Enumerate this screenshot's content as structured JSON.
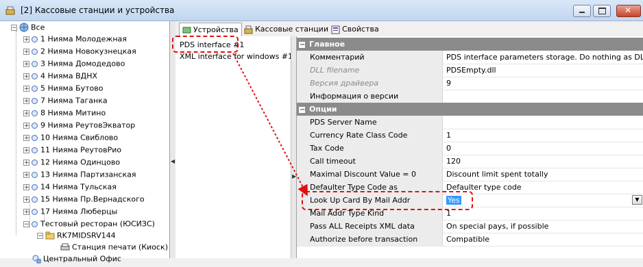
{
  "window": {
    "title": "[2] Кассовые станции и устройства"
  },
  "tree": {
    "root": "Все",
    "items": [
      "1 Нияма Молодежная",
      "2 Нияма Новокузнецкая",
      "3 Нияма Домодедово",
      "4 Нияма ВДНХ",
      "5 Нияма Бутово",
      "7 Нияма Таганка",
      "8 Нияма Митино",
      "9 Нияма РеутовЭкватор",
      "10 Нияма Свиблово",
      "11 Нияма РеутовРио",
      "12 Нияма Одинцово",
      "13 Нияма Партизанская",
      "14 Нияма Тульская",
      "15 Нияма Пр.Вернадского",
      "17 Нияма Люберцы",
      "Тестовый ресторан (ЮСИЗС)"
    ],
    "station": "RK7MIDSRV144",
    "device": "Станция печати (Киоск)",
    "office": "Центральный Офис"
  },
  "tabs": [
    {
      "label": "Устройства"
    },
    {
      "label": "Кассовые станции"
    },
    {
      "label": "Свойства"
    }
  ],
  "interfaces": [
    "PDS interface #1",
    "XML interface for windows #1"
  ],
  "grid": {
    "cat_main": "Главное",
    "main_rows": [
      {
        "name": "Комментарий",
        "value": "PDS interface parameters storage. Do nothing as DLL.",
        "readonly": false
      },
      {
        "name": "DLL filename",
        "value": "PDSEmpty.dll",
        "readonly": true
      },
      {
        "name": "Версия драйвера",
        "value": "9",
        "readonly": true
      },
      {
        "name": "Информация о версии",
        "value": "",
        "readonly": false
      }
    ],
    "cat_options": "Опции",
    "option_rows": [
      {
        "name": "PDS Server Name",
        "value": ""
      },
      {
        "name": "Currency Rate Class Code",
        "value": "1"
      },
      {
        "name": "Tax Code",
        "value": "0"
      },
      {
        "name": "Call timeout",
        "value": "120"
      },
      {
        "name": "Maximal Discount Value = 0",
        "value": "Discount limit spent totally"
      },
      {
        "name": "Defaulter Type Code as",
        "value": "Defaulter type code"
      },
      {
        "name": "Look Up Card By Mail Addr",
        "value": "Yes"
      },
      {
        "name": "Mail Addr Type Kind",
        "value": "1"
      },
      {
        "name": "Pass ALL Receipts XML data",
        "value": "On special pays, if possible"
      },
      {
        "name": "Authorize before transaction",
        "value": "Compatible"
      }
    ]
  },
  "colors": {
    "accent_red": "#e01010",
    "selection": "#3399ff",
    "category_bg": "#8b8b8b"
  }
}
